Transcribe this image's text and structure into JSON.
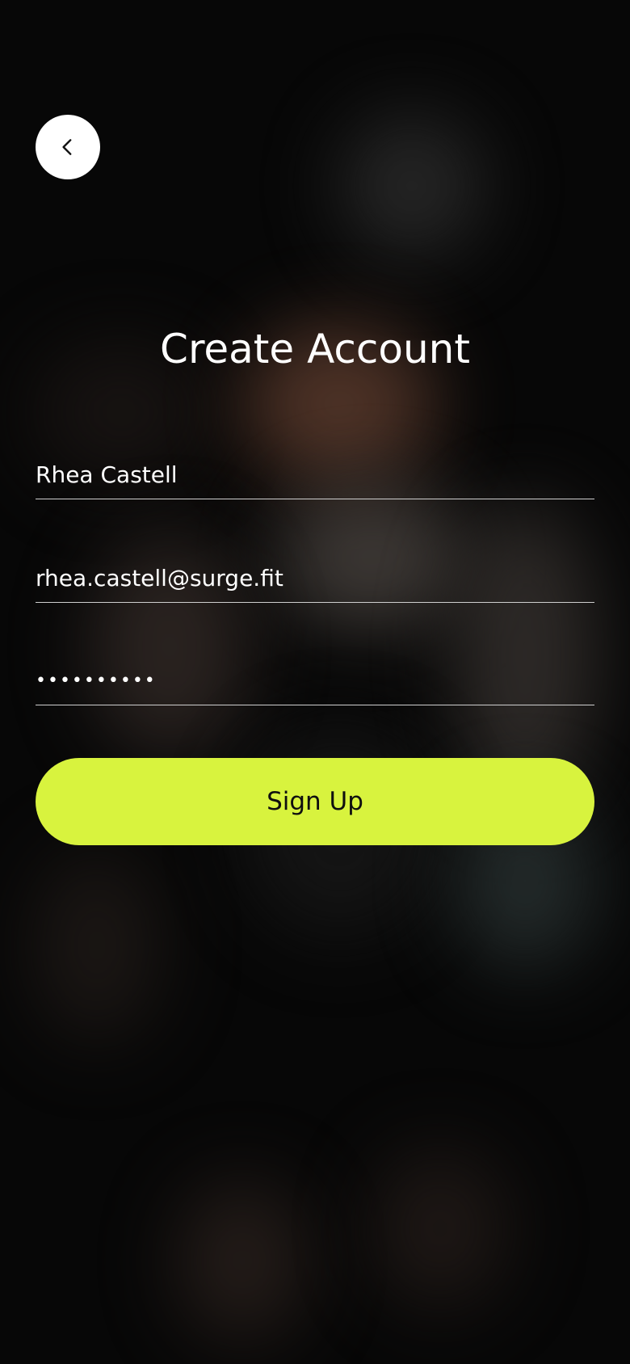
{
  "header": {
    "back_icon": "chevron-left-icon"
  },
  "main": {
    "title": "Create Account"
  },
  "form": {
    "name_value": "Rhea Castell",
    "email_value": "rhea.castell@surge.fit",
    "password_value": "••••••••••"
  },
  "actions": {
    "signup_label": "Sign Up"
  },
  "colors": {
    "accent": "#d8f33e",
    "background": "#070707",
    "text": "#ffffff"
  }
}
